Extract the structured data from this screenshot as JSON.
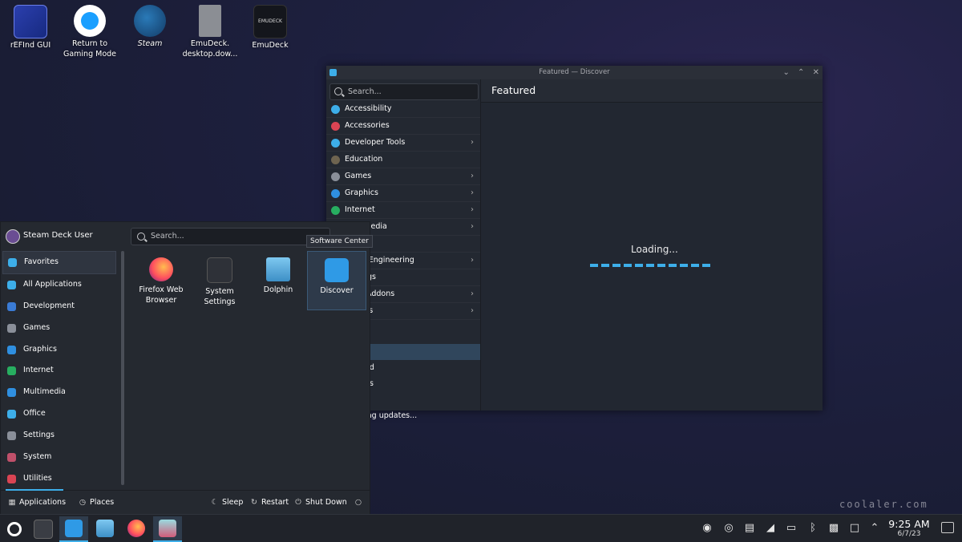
{
  "desktop": {
    "icons": [
      {
        "label": "rEFInd GUI"
      },
      {
        "label": "Return to Gaming Mode"
      },
      {
        "label": "Steam"
      },
      {
        "label": "EmuDeck. desktop.dow..."
      },
      {
        "label": "EmuDeck",
        "badge_text": "EMUDECK"
      }
    ]
  },
  "discover": {
    "title": "Featured — Discover",
    "search_placeholder": "Search...",
    "heading": "Featured",
    "loading_text": "Loading...",
    "categories": [
      {
        "label": "Accessibility",
        "color": "#3daee9",
        "has_children": false
      },
      {
        "label": "Accessories",
        "color": "#da4453",
        "has_children": false
      },
      {
        "label": "Developer Tools",
        "color": "#3daee9",
        "has_children": true
      },
      {
        "label": "Education",
        "color": "#6e6450",
        "has_children": false
      },
      {
        "label": "Games",
        "color": "#8a8f99",
        "has_children": true
      },
      {
        "label": "Graphics",
        "color": "#2f8fe0",
        "has_children": true
      },
      {
        "label": "Internet",
        "color": "#27ae60",
        "has_children": true
      },
      {
        "label": "Multimedia",
        "color": "#2f8fe0",
        "has_children": true
      },
      {
        "label": "",
        "color": "#8a8f99",
        "has_children": false
      },
      {
        "label": "e and Engineering",
        "color": "#8a8f99",
        "has_children": true
      },
      {
        "label": "Settings",
        "color": "#8a8f99",
        "has_children": false
      },
      {
        "label": "ation Addons",
        "color": "#8a8f99",
        "has_children": true
      },
      {
        "label": "Addons",
        "color": "#8a8f99",
        "has_children": true
      }
    ],
    "lower_items": [
      {
        "label": "",
        "selected": true
      },
      {
        "label": "ed",
        "selected": false
      },
      {
        "label": "gs",
        "selected": false
      },
      {
        "label": "",
        "selected": false
      },
      {
        "label": "ing updates...",
        "selected": false
      }
    ]
  },
  "start_menu": {
    "user_name": "Steam Deck User",
    "search_placeholder": "Search...",
    "tooltip": "Software Center",
    "categories": [
      {
        "label": "Favorites",
        "color": "#3daee9",
        "selected": true
      },
      {
        "label": "All Applications",
        "color": "#3daee9",
        "selected": false
      },
      {
        "label": "Development",
        "color": "#3a7bd5",
        "selected": false
      },
      {
        "label": "Games",
        "color": "#8a8f99",
        "selected": false
      },
      {
        "label": "Graphics",
        "color": "#2f8fe0",
        "selected": false
      },
      {
        "label": "Internet",
        "color": "#27ae60",
        "selected": false
      },
      {
        "label": "Multimedia",
        "color": "#2f8fe0",
        "selected": false
      },
      {
        "label": "Office",
        "color": "#3daee9",
        "selected": false
      },
      {
        "label": "Settings",
        "color": "#8a8f99",
        "selected": false
      },
      {
        "label": "System",
        "color": "#c0506a",
        "selected": false
      },
      {
        "label": "Utilities",
        "color": "#da4453",
        "selected": false
      }
    ],
    "favorites": [
      {
        "label": "Firefox Web Browser"
      },
      {
        "label": "System Settings"
      },
      {
        "label": "Dolphin"
      },
      {
        "label": "Discover"
      }
    ],
    "footer": {
      "applications": "Applications",
      "places": "Places",
      "sleep": "Sleep",
      "restart": "Restart",
      "shutdown": "Shut Down"
    }
  },
  "taskbar": {
    "time": "9:25 AM",
    "date": "6/7/23"
  },
  "watermark": "coolaler.com",
  "colors": {
    "accent": "#3daee9",
    "panel": "#20232a",
    "window": "#222731"
  }
}
